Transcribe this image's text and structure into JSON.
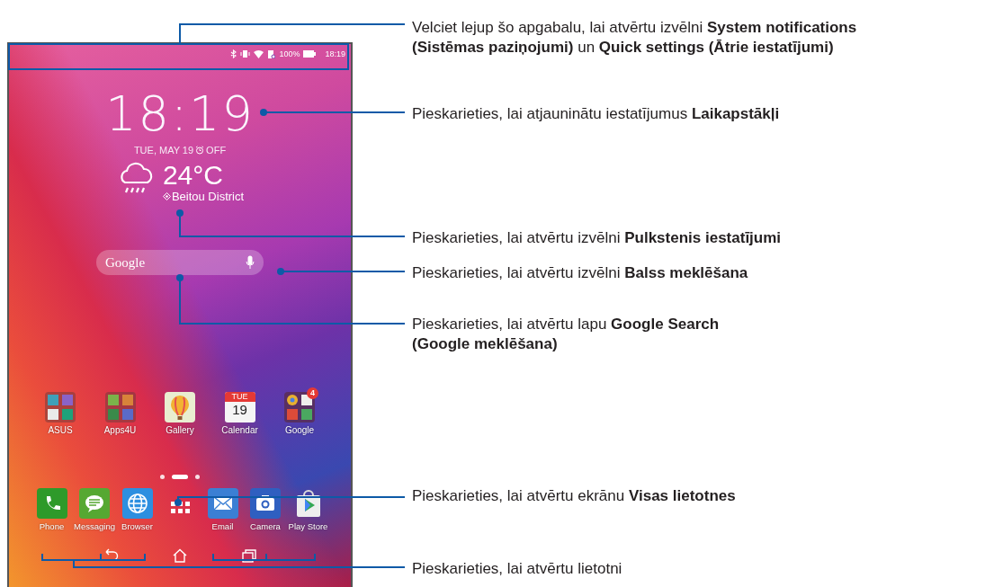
{
  "phone": {
    "status_bar": {
      "battery_level": "100%",
      "time": "18:19"
    },
    "clock_widget": {
      "time": "18:19",
      "date": "TUE, MAY 19",
      "alarm": "OFF"
    },
    "weather_widget": {
      "temperature": "24°C",
      "location": "Beitou District"
    },
    "search_bar": {
      "placeholder": "Google"
    },
    "home_apps": [
      {
        "kind": "asus-folder",
        "label": "ASUS"
      },
      {
        "kind": "apps-folder",
        "label": "Apps4U"
      },
      {
        "kind": "gallery",
        "label": "Gallery"
      },
      {
        "kind": "calendar",
        "label": "Calendar",
        "icon_day": "TUE",
        "icon_date": "19"
      },
      {
        "kind": "google-folder",
        "label": "Google",
        "badge": "4"
      }
    ],
    "page_indicators": [
      {
        "selected": false
      },
      {
        "selected": true
      },
      {
        "selected": false
      }
    ],
    "dock": [
      {
        "kind": "phone",
        "label": "Phone"
      },
      {
        "kind": "messaging",
        "label": "Messaging"
      },
      {
        "kind": "browser",
        "label": "Browser"
      },
      {
        "kind": "drawer"
      },
      {
        "kind": "email",
        "label": "Email"
      },
      {
        "kind": "camera",
        "label": "Camera"
      },
      {
        "kind": "store",
        "label": "Play Store"
      }
    ],
    "nav_bar": [
      {
        "kind": "back"
      },
      {
        "kind": "home"
      },
      {
        "kind": "recents"
      }
    ]
  },
  "callouts": [
    {
      "lines": [
        "Velciet lejup šo apgabalu, lai atvērtu izvēlni **System notifications**",
        "**(Sistēmas paziņojumi)** un **Quick settings (Ātrie iestatījumi)**"
      ]
    },
    {
      "lines": [
        "Pieskarieties, lai atjauninātu iestatījumus **Laikapstākļi**"
      ]
    },
    {
      "lines": [
        "Pieskarieties, lai atvērtu izvēlni **Pulkstenis iestatījumi**"
      ]
    },
    {
      "lines": [
        "Pieskarieties, lai atvērtu izvēlni **Balss meklēšana**"
      ]
    },
    {
      "lines": [
        "Pieskarieties, lai atvērtu lapu **Google Search**",
        "**(Google meklēšana)**"
      ]
    },
    {
      "lines": [
        "Pieskarieties, lai atvērtu ekrānu **Visas lietotnes**"
      ]
    },
    {
      "lines": [
        "Pieskarieties, lai atvērtu lietotni"
      ]
    }
  ]
}
